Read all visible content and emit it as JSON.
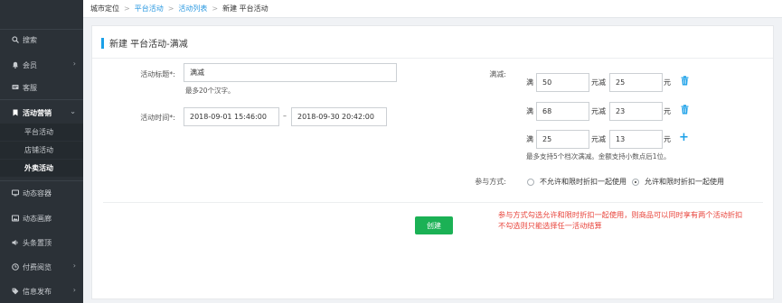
{
  "breadcrumb": {
    "city": "城市定位",
    "platform": "平台活动",
    "list": "活动列表",
    "current": "新建 平台活动",
    "sep": ">"
  },
  "sidebar": {
    "items": [
      {
        "label": "搜索"
      },
      {
        "label": "会员"
      },
      {
        "label": "客服"
      },
      {
        "label": "活动营销"
      },
      {
        "label": "动态容器"
      },
      {
        "label": "动态画廊"
      },
      {
        "label": "头条置顶"
      },
      {
        "label": "付费阅览"
      },
      {
        "label": "信息发布"
      }
    ],
    "sub_items": [
      {
        "label": "平台活动"
      },
      {
        "label": "店铺活动"
      },
      {
        "label": "外卖活动"
      }
    ]
  },
  "form": {
    "title": "新建 平台活动-满减",
    "title_label": "活动标题*:",
    "title_value": "满减",
    "title_hint": "最多20个汉字。",
    "time_label": "活动时间*:",
    "start_time": "2018-09-01 15:46:00",
    "end_time": "2018-09-30 20:42:00",
    "range_dash": "–",
    "discount_label": "满减:",
    "prefix": "满",
    "mid": "元减",
    "suffix": "元",
    "tiers": [
      {
        "full": "50",
        "minus": "25"
      },
      {
        "full": "68",
        "minus": "23"
      },
      {
        "full": "25",
        "minus": "13"
      }
    ],
    "tier_hint": "最多支持5个档次满减。金额支持小数点后1位。",
    "mode_label": "参与方式:",
    "mode_options": [
      {
        "label": "不允许和限时折扣一起使用",
        "selected": false
      },
      {
        "label": "允许和限时折扣一起使用",
        "selected": true
      }
    ],
    "submit": "创建"
  },
  "annotation": {
    "line1": "参与方式勾选允许和限时折扣一起使用，则商品可以同时享有两个活动折扣",
    "line2": "不勾选则只能选择任一活动结算"
  },
  "colors": {
    "accent": "#1aa0e8",
    "sidebar_bg": "#2b3137",
    "button": "#1bb155",
    "note": "#e8453c"
  }
}
